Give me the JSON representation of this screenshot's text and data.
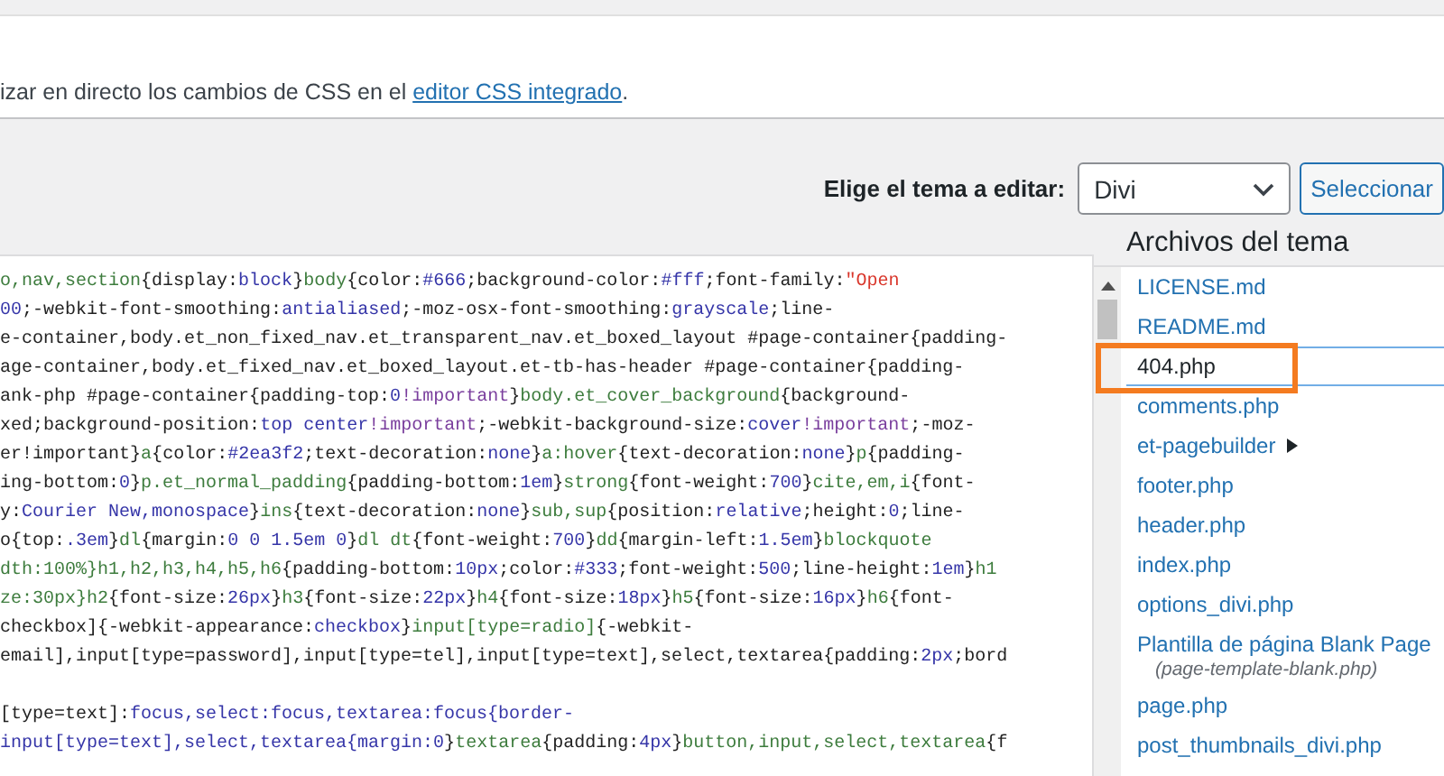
{
  "notice": {
    "text_before": "izar en directo los cambios de CSS en el ",
    "link": "editor CSS integrado",
    "text_after": "."
  },
  "theme_picker": {
    "label": "Elige el tema a editar:",
    "value": "Divi",
    "button": "Seleccionar"
  },
  "editor": {
    "lines": [
      {
        "text": "o,nav,section{display:block}body{color:#666;background-color:#fff;font-family:\"Open"
      },
      {
        "text": "00;-webkit-font-smoothing:antialiased;-moz-osx-font-smoothing:grayscale;line-"
      },
      {
        "text": "e-container,body.et_non_fixed_nav.et_transparent_nav.et_boxed_layout #page-container{padding-"
      },
      {
        "text": "age-container,body.et_fixed_nav.et_boxed_layout.et-tb-has-header #page-container{padding-"
      },
      {
        "text": "ank-php #page-container{padding-top:0!important}body.et_cover_background{background-"
      },
      {
        "text": "xed;background-position:top center!important;-webkit-background-size:cover!important;-moz-"
      },
      {
        "text": "er!important}a{color:#2ea3f2;text-decoration:none}a:hover{text-decoration:none}p{padding-"
      },
      {
        "text": "ing-bottom:0}p.et_normal_padding{padding-bottom:1em}strong{font-weight:700}cite,em,i{font-"
      },
      {
        "text": "y:Courier New,monospace}ins{text-decoration:none}sub,sup{position:relative;height:0;line-"
      },
      {
        "text": "o{top:.3em}dl{margin:0 0 1.5em 0}dl dt{font-weight:700}dd{margin-left:1.5em}blockquote"
      },
      {
        "text": "dth:100%}h1,h2,h3,h4,h5,h6{padding-bottom:10px;color:#333;font-weight:500;line-height:1em}h1"
      },
      {
        "text": "ze:30px}h2{font-size:26px}h3{font-size:22px}h4{font-size:18px}h5{font-size:16px}h6{font-"
      },
      {
        "text": "checkbox]{-webkit-appearance:checkbox}input[type=radio]{-webkit-"
      },
      {
        "text": "email],input[type=password],input[type=tel],input[type=text],select,textarea{padding:2px;bord"
      },
      {
        "text": "[type=text]:focus,select:focus,textarea:focus{border-",
        "blank_before": true
      },
      {
        "text": "input[type=text],select,textarea{margin:0}textarea{padding:4px}button,input,select,textarea{f"
      }
    ]
  },
  "files": {
    "title": "Archivos del tema",
    "items": [
      {
        "kind": "file",
        "label": "LICENSE.md",
        "selected": false,
        "highlighted": false
      },
      {
        "kind": "file",
        "label": "README.md",
        "selected": false,
        "highlighted": false
      },
      {
        "kind": "file",
        "label": "404.php",
        "selected": true,
        "highlighted": true
      },
      {
        "kind": "file",
        "label": "comments.php",
        "selected": false,
        "highlighted": false
      },
      {
        "kind": "folder",
        "label": "et-pagebuilder",
        "selected": false,
        "highlighted": false
      },
      {
        "kind": "file",
        "label": "footer.php",
        "selected": false,
        "highlighted": false
      },
      {
        "kind": "file",
        "label": "header.php",
        "selected": false,
        "highlighted": false
      },
      {
        "kind": "file",
        "label": "index.php",
        "selected": false,
        "highlighted": false
      },
      {
        "kind": "file",
        "label": "options_divi.php",
        "selected": false,
        "highlighted": false
      },
      {
        "kind": "file",
        "label": "Plantilla de página Blank Page",
        "description": "(page-template-blank.php)",
        "selected": false,
        "highlighted": false
      },
      {
        "kind": "file",
        "label": "page.php",
        "selected": false,
        "highlighted": false
      },
      {
        "kind": "file",
        "label": "post_thumbnails_divi.php",
        "selected": false,
        "highlighted": false
      }
    ]
  }
}
